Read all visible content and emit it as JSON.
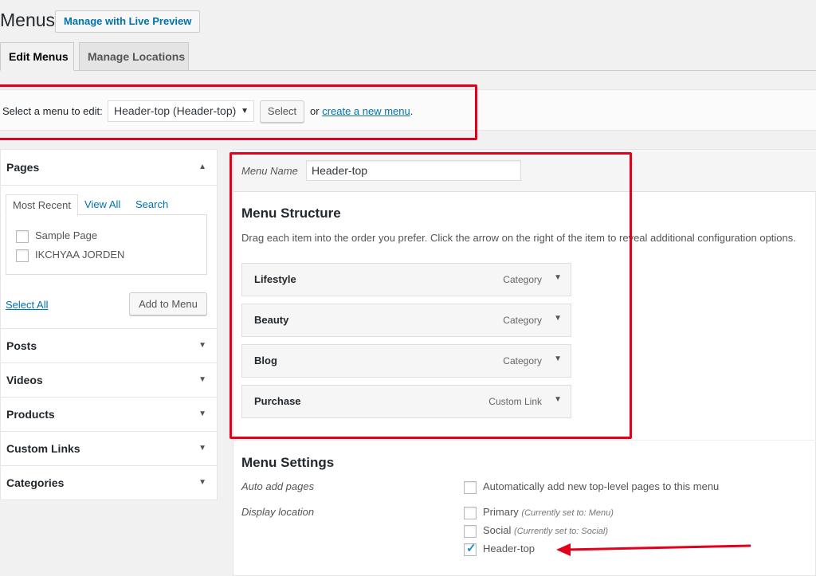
{
  "header": {
    "title": "Menus",
    "live_preview_button": "Manage with Live Preview"
  },
  "tabs": [
    {
      "label": "Edit Menus",
      "active": true
    },
    {
      "label": "Manage Locations",
      "active": false
    }
  ],
  "manage_bar": {
    "label": "Select a menu to edit:",
    "selected_menu": "Header-top (Header-top)",
    "select_button": "Select",
    "or_text": "or",
    "create_link": "create a new menu",
    "period": "."
  },
  "sidebar": {
    "pages": {
      "title": "Pages",
      "tabs": [
        "Most Recent",
        "View All",
        "Search"
      ],
      "items": [
        {
          "label": "Sample Page",
          "checked": false
        },
        {
          "label": "IKCHYAA JORDEN",
          "checked": false
        }
      ],
      "select_all": "Select All",
      "add_button": "Add to Menu"
    },
    "sections": [
      "Posts",
      "Videos",
      "Products",
      "Custom Links",
      "Categories"
    ]
  },
  "menu": {
    "name_label": "Menu Name",
    "name_value": "Header-top",
    "structure_title": "Menu Structure",
    "structure_desc": "Drag each item into the order you prefer. Click the arrow on the right of the item to reveal additional configuration options.",
    "items": [
      {
        "title": "Lifestyle",
        "type": "Category"
      },
      {
        "title": "Beauty",
        "type": "Category"
      },
      {
        "title": "Blog",
        "type": "Category"
      },
      {
        "title": "Purchase",
        "type": "Custom Link"
      }
    ],
    "settings": {
      "title": "Menu Settings",
      "auto_add_label": "Auto add pages",
      "auto_add_option": "Automatically add new top-level pages to this menu",
      "auto_add_checked": false,
      "display_location_label": "Display location",
      "locations": [
        {
          "label": "Primary",
          "note": "(Currently set to: Menu)",
          "checked": false
        },
        {
          "label": "Social",
          "note": "(Currently set to: Social)",
          "checked": false
        },
        {
          "label": "Header-top",
          "note": "",
          "checked": true
        }
      ]
    }
  },
  "colors": {
    "highlight": "#e3001b",
    "link": "#0073aa"
  }
}
